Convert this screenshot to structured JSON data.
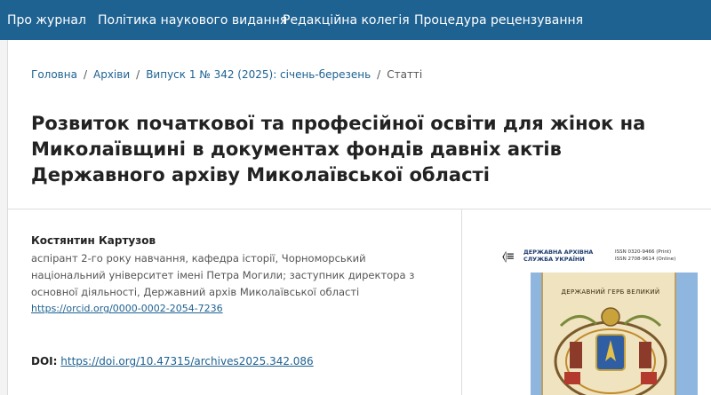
{
  "nav": {
    "items": [
      "Про журнал",
      "Політика наукового видання",
      "Редакційна колегія",
      "Процедура рецензування"
    ]
  },
  "breadcrumb": {
    "home": "Головна",
    "archives": "Архіви",
    "issue": "Випуск 1 № 342 (2025): січень-березень",
    "current": "Статті",
    "separator": "/"
  },
  "article": {
    "title": "Розвиток початкової та професійної освіти для жінок на Миколаївщині в документах фондів давніх актів Державного архіву Миколаївської області",
    "author_name": "Костянтин Картузов",
    "affiliation": "аспірант 2-го року навчання, кафедра історії, Чорноморський національний університет імені Петра Могили; заступник директора з основної діяльності, Державний архів Миколаївської області",
    "orcid": "https://orcid.org/0000-0002-2054-7236",
    "doi_label": "DOI:",
    "doi_link": "https://doi.org/10.47315/archives2025.342.086"
  },
  "cover": {
    "org": "ДЕРЖАВНА АРХІВНА СЛУЖБА УКРАЇНИ",
    "issn_print": "ISSN 0320-9466 (Print)",
    "issn_online": "ISSN 2708-9614 (Online)",
    "caption": "ДЕРЖАВНИЙ ГЕРБ ВЕЛИКИЙ"
  },
  "colors": {
    "brand": "#1e6292",
    "link": "#1e6292"
  }
}
